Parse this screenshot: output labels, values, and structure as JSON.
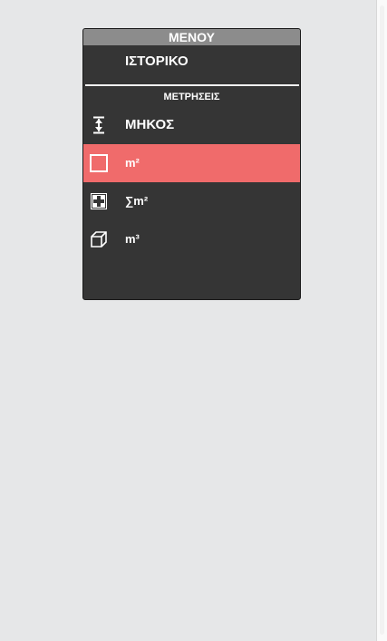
{
  "menu": {
    "title": "ΜΕΝΟΥ",
    "history_label": "ΙΣΤΟΡΙΚΟ",
    "section_label": "ΜΕΤΡΗΣΕΙΣ",
    "items": [
      {
        "label": "ΜΗΚΟΣ",
        "icon": "length-measure-icon",
        "active": false
      },
      {
        "label": "m²",
        "icon": "area-square-icon",
        "active": true
      },
      {
        "label": "∑m²",
        "icon": "area-sum-plus-icon",
        "active": false
      },
      {
        "label": "m³",
        "icon": "volume-cube-icon",
        "active": false
      }
    ]
  },
  "colors": {
    "menu_background": "#353535",
    "header_background": "#8c8c8c",
    "active_item": "#f06b6b",
    "page_background": "#e6e7e8"
  }
}
